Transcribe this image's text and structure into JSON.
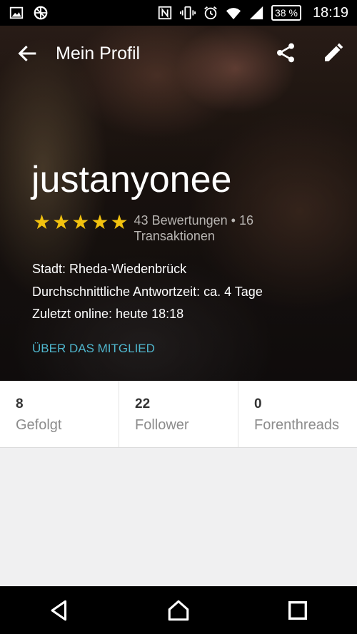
{
  "status_bar": {
    "battery": "38 %",
    "time": "18:19",
    "icons": [
      "image-icon",
      "vpn-icon",
      "nfc-icon",
      "vibrate-icon",
      "alarm-icon",
      "wifi-icon",
      "signal-icon"
    ]
  },
  "toolbar": {
    "title": "Mein Profil",
    "back_icon": "arrow-back-icon",
    "share_icon": "share-icon",
    "edit_icon": "edit-pencil-icon"
  },
  "profile": {
    "username": "justanyonee",
    "rating_stars": 5,
    "rating_text": "43 Bewertungen • 16 Transaktionen",
    "city": "Stadt:  Rheda-Wiedenbrück",
    "response_time": "Durchschnittliche Antwortzeit:  ca. 4 Tage",
    "last_online": "Zuletzt online: heute 18:18",
    "about_link": "ÜBER DAS MITGLIED"
  },
  "stats": [
    {
      "count": "8",
      "label": "Gefolgt"
    },
    {
      "count": "22",
      "label": "Follower"
    },
    {
      "count": "0",
      "label": "Forenthreads"
    }
  ],
  "colors": {
    "star": "#f2c20f",
    "link": "#4fb6cd",
    "background": "#f0f0f1"
  },
  "nav_bar": {
    "icons": [
      "nav-back-icon",
      "nav-home-icon",
      "nav-recents-icon"
    ]
  }
}
